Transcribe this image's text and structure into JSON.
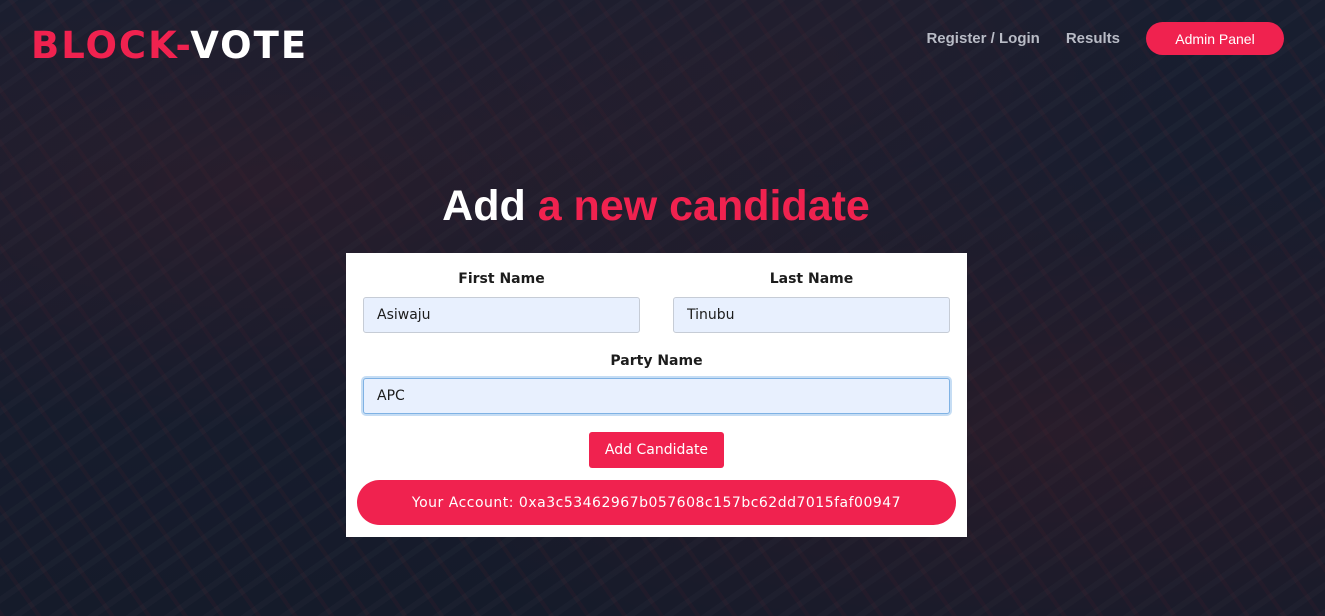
{
  "brand": {
    "part1": "BLOCK-",
    "part2": "VOTE"
  },
  "nav": {
    "register_login": "Register / Login",
    "results": "Results",
    "admin_panel": "Admin Panel"
  },
  "headline": {
    "lead": "Add",
    "accent": "a new candidate"
  },
  "form": {
    "first_name": {
      "label": "First Name",
      "value": "Asiwaju"
    },
    "last_name": {
      "label": "Last Name",
      "value": "Tinubu"
    },
    "party_name": {
      "label": "Party Name",
      "value": "APC"
    },
    "submit_label": "Add Candidate"
  },
  "account": {
    "text": "Your Account: 0xa3c53462967b057608c157bc62dd7015faf00947"
  },
  "colors": {
    "accent": "#f0224f",
    "input_bg": "#e8f0fe",
    "background": "#1d2333"
  }
}
